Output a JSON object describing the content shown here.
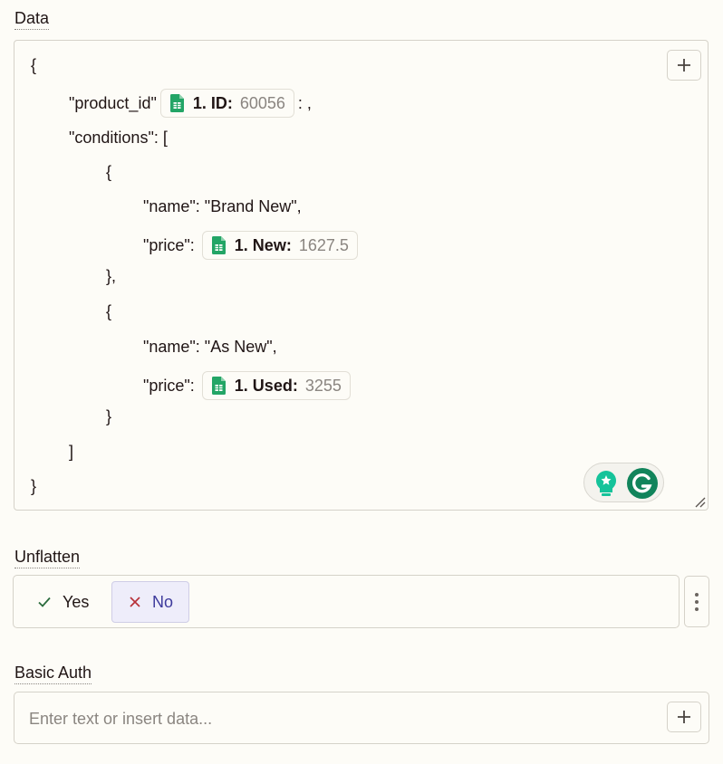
{
  "data_field": {
    "label": "Data",
    "lines": {
      "l1": "{",
      "l2_key": "\"product_id\"",
      "l2_suffix": ": ,",
      "l3": "\"conditions\": [",
      "l4": "{",
      "l5": "\"name\": \"Brand New\",",
      "l6_key": "\"price\":",
      "l7": "},",
      "l8": "{",
      "l9": "\"name\": \"As New\",",
      "l10_key": "\"price\":",
      "l11": "}",
      "l12": "]",
      "l13": "}"
    },
    "pills": {
      "id": {
        "label": "1. ID:",
        "value": "60056",
        "icon": "google-sheets-icon"
      },
      "new": {
        "label": "1. New:",
        "value": "1627.5",
        "icon": "google-sheets-icon"
      },
      "used": {
        "label": "1. Used:",
        "value": "3255",
        "icon": "google-sheets-icon"
      }
    },
    "insert_button_icon": "plus-icon"
  },
  "unflatten_field": {
    "label": "Unflatten",
    "options": {
      "yes": {
        "label": "Yes",
        "icon": "check-icon"
      },
      "no": {
        "label": "No",
        "icon": "x-icon",
        "selected": true
      }
    },
    "menu_icon": "kebab-menu-icon"
  },
  "basic_auth_field": {
    "label": "Basic Auth",
    "placeholder": "Enter text or insert data...",
    "value": "",
    "insert_button_icon": "plus-icon"
  },
  "colors": {
    "background": "#fdfcf7",
    "border": "#d5d2c9",
    "selected_bg": "#eeedfa",
    "selected_text": "#3d3a9c",
    "sheets_green": "#23a566",
    "grammarly_green": "#15c39a"
  }
}
